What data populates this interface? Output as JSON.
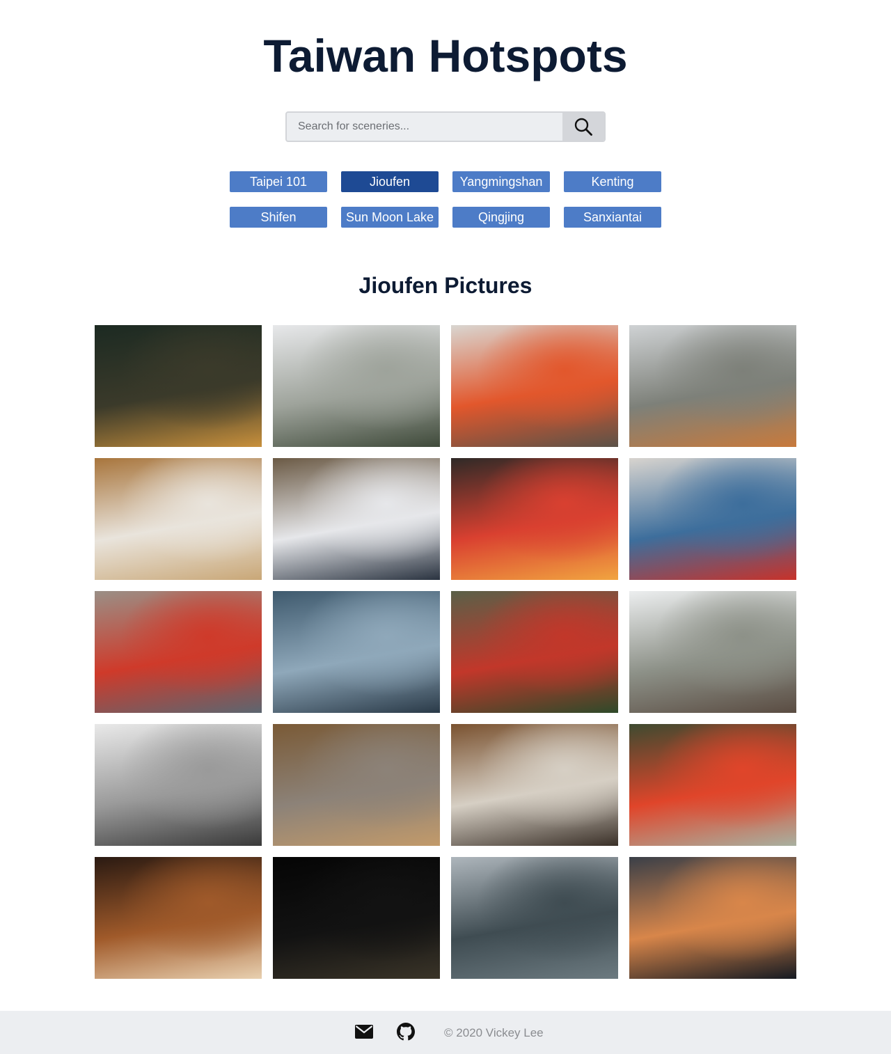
{
  "header": {
    "title": "Taiwan Hotspots"
  },
  "search": {
    "placeholder": "Search for sceneries...",
    "value": "",
    "button_icon": "search-icon"
  },
  "tags": [
    {
      "label": "Taipei 101",
      "active": false
    },
    {
      "label": "Jioufen",
      "active": true
    },
    {
      "label": "Yangmingshan",
      "active": false
    },
    {
      "label": "Kenting",
      "active": false
    },
    {
      "label": "Shifen",
      "active": false
    },
    {
      "label": "Sun Moon Lake",
      "active": false
    },
    {
      "label": "Qingjing",
      "active": false
    },
    {
      "label": "Sanxiantai",
      "active": false
    }
  ],
  "gallery": {
    "title": "Jioufen Pictures",
    "photos": [
      {
        "colors": [
          "#1c2a22",
          "#3b3a2a",
          "#c8903c"
        ]
      },
      {
        "colors": [
          "#e7e8ea",
          "#9ea39b",
          "#3f4a3a"
        ]
      },
      {
        "colors": [
          "#d9d6d1",
          "#e2572c",
          "#5b5248"
        ]
      },
      {
        "colors": [
          "#cfd2d4",
          "#7d8079",
          "#c87a3c"
        ]
      },
      {
        "colors": [
          "#a8753c",
          "#e9e4dc",
          "#c9a777"
        ]
      },
      {
        "colors": [
          "#6b5a45",
          "#e6e7ea",
          "#2a3340"
        ]
      },
      {
        "colors": [
          "#2f2a27",
          "#d94030",
          "#f1a440"
        ]
      },
      {
        "colors": [
          "#d8d4cf",
          "#3d6e9c",
          "#c8322a"
        ]
      },
      {
        "colors": [
          "#9a8f86",
          "#cf3a2a",
          "#5c6670"
        ]
      },
      {
        "colors": [
          "#3f5a6e",
          "#8fa8ba",
          "#2a3a48"
        ]
      },
      {
        "colors": [
          "#5a6048",
          "#c2372a",
          "#2e4a2a"
        ]
      },
      {
        "colors": [
          "#eceeef",
          "#8d9188",
          "#5a4c42"
        ]
      },
      {
        "colors": [
          "#e9e9e9",
          "#9a9a9a",
          "#3a3a3a"
        ]
      },
      {
        "colors": [
          "#7a5a36",
          "#8c8278",
          "#c29a6a"
        ]
      },
      {
        "colors": [
          "#7a5230",
          "#d6cfc4",
          "#3a3028"
        ]
      },
      {
        "colors": [
          "#3e4a30",
          "#e0452a",
          "#a8b0a0"
        ]
      },
      {
        "colors": [
          "#2a1a12",
          "#a05a2a",
          "#e8d0b0"
        ]
      },
      {
        "colors": [
          "#050505",
          "#121212",
          "#3a3428"
        ]
      },
      {
        "colors": [
          "#aeb6bc",
          "#3f4c52",
          "#6c7a80"
        ]
      },
      {
        "colors": [
          "#3a3f48",
          "#d8864a",
          "#151a22"
        ]
      }
    ]
  },
  "footer": {
    "email_icon": "mail-icon",
    "github_icon": "github-icon",
    "copyright": "© 2020 Vickey Lee"
  }
}
